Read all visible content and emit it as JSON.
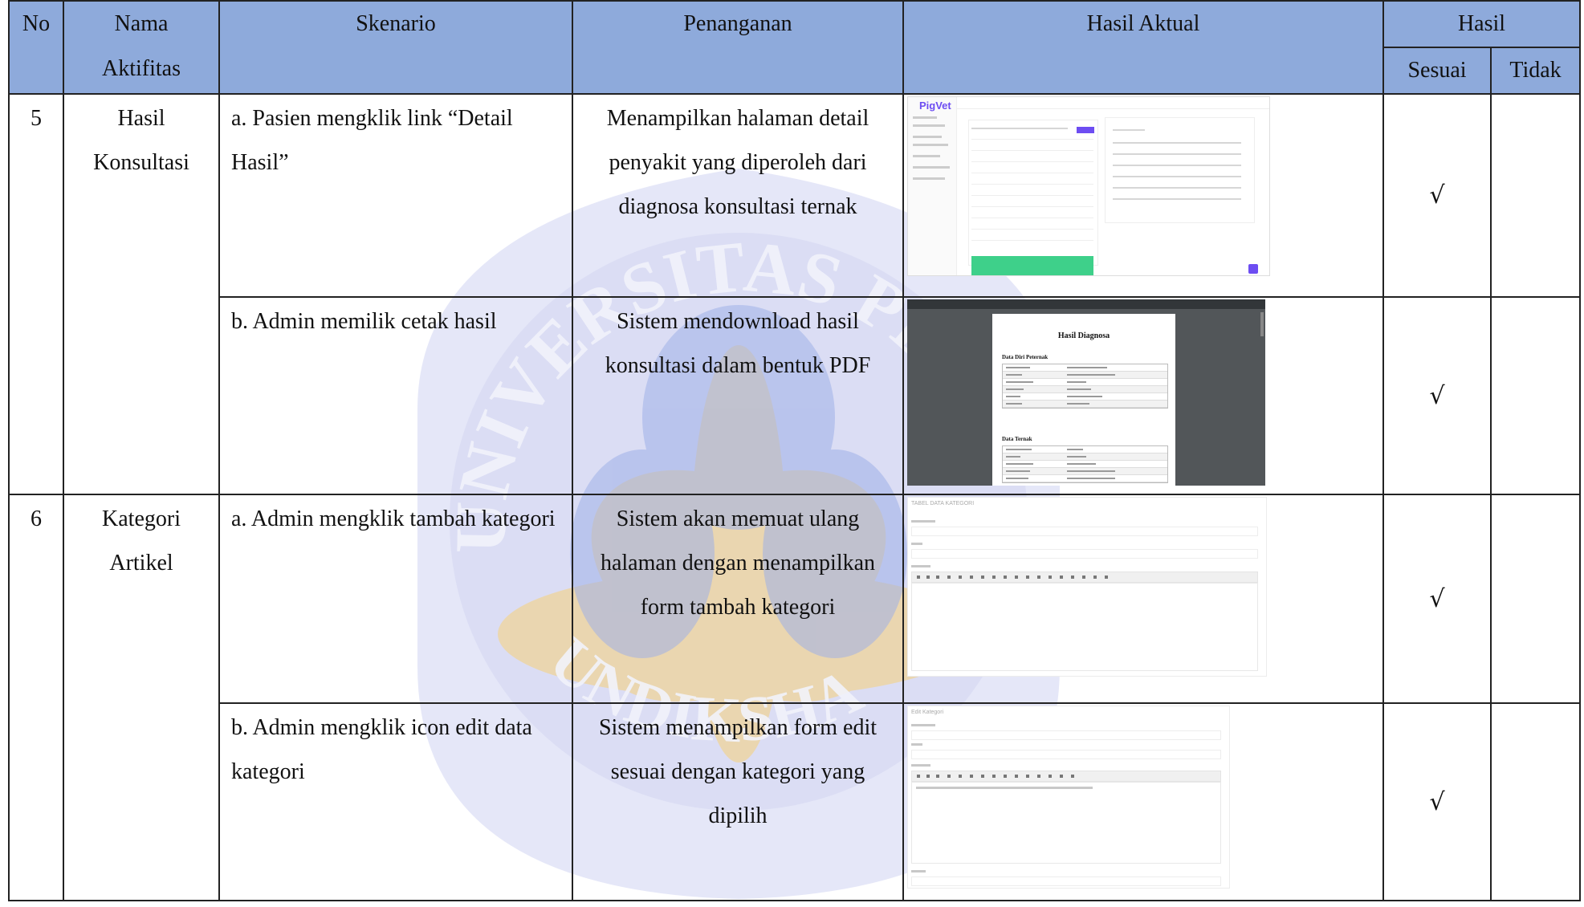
{
  "headers": {
    "no": "No",
    "nama": "Nama",
    "aktifitas": "Aktifitas",
    "skenario": "Skenario",
    "penanganan": "Penanganan",
    "hasil_aktual": "Hasil Aktual",
    "hasil": "Hasil",
    "sesuai": "Sesuai",
    "tidak": "Tidak"
  },
  "rows": [
    {
      "no": "5",
      "nama_line1": "Hasil",
      "nama_line2": "Konsultasi",
      "cases": [
        {
          "skenario": "a. Pasien mengklik link “Detail Hasil”",
          "penanganan": "Menampilkan halaman detail penyakit yang diperoleh dari diagnosa konsultasi ternak",
          "sesuai": "√",
          "tidak": "",
          "screenshot": {
            "app_name": "PigVet"
          }
        },
        {
          "skenario": "b. Admin memilik cetak hasil",
          "penanganan": "Sistem mendownload hasil konsultasi dalam bentuk PDF",
          "sesuai": "√",
          "tidak": "",
          "screenshot": {
            "title": "Hasil Diagnosa",
            "section1": "Data Diri Peternak",
            "section2": "Data Ternak"
          }
        }
      ]
    },
    {
      "no": "6",
      "nama_line1": "Kategori",
      "nama_line2": "Artikel",
      "cases": [
        {
          "skenario": "a. Admin mengklik tambah kategori",
          "penanganan": "Sistem akan memuat ulang halaman dengan menampilkan form tambah kategori",
          "sesuai": "√",
          "tidak": "",
          "screenshot": {
            "title": "TABEL DATA KATEGORI"
          }
        },
        {
          "skenario": "b. Admin mengklik icon edit data kategori",
          "penanganan": "Sistem menampilkan form edit sesuai dengan kategori yang dipilih",
          "sesuai": "√",
          "tidak": "",
          "screenshot": {
            "title": "Edit Kategori"
          }
        }
      ]
    }
  ],
  "watermark": {
    "text_top": "UNIVERSITAS PENDIDIKAN",
    "text_bottom": "UNDIKSHA",
    "ring_color": "#3d3dbf",
    "fill_color": "#d8dbf3",
    "accent_color": "#f5c04a"
  }
}
